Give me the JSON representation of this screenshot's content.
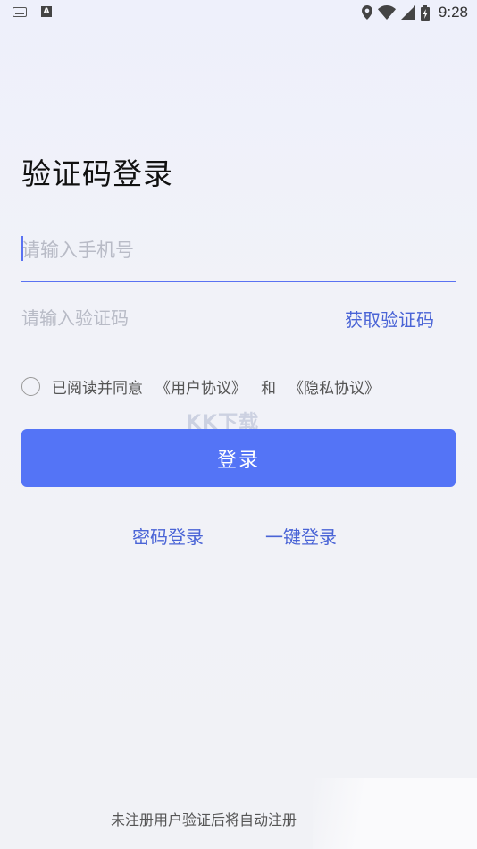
{
  "status_bar": {
    "time": "9:28",
    "left_icons": [
      "keyboard-icon",
      "a-icon"
    ],
    "right_icons": [
      "location-icon",
      "wifi-icon",
      "signal-icon",
      "battery-charging-icon"
    ]
  },
  "title": "验证码登录",
  "phone_field": {
    "placeholder": "请输入手机号",
    "value": ""
  },
  "code_field": {
    "placeholder": "请输入验证码",
    "value": ""
  },
  "get_code_label": "获取验证码",
  "agreement": {
    "checked": false,
    "prefix": "已阅读并同意",
    "user_agreement": "《用户协议》",
    "conjunction": "和",
    "privacy_policy": "《隐私协议》"
  },
  "watermark": "KK下载",
  "login_button_label": "登录",
  "alt_logins": {
    "password_label": "密码登录",
    "one_key_label": "一键登录"
  },
  "footer_text": "未注册用户验证后将自动注册",
  "colors": {
    "accent": "#5474f6",
    "link": "#4a64d6",
    "placeholder": "#b8bbc6"
  }
}
